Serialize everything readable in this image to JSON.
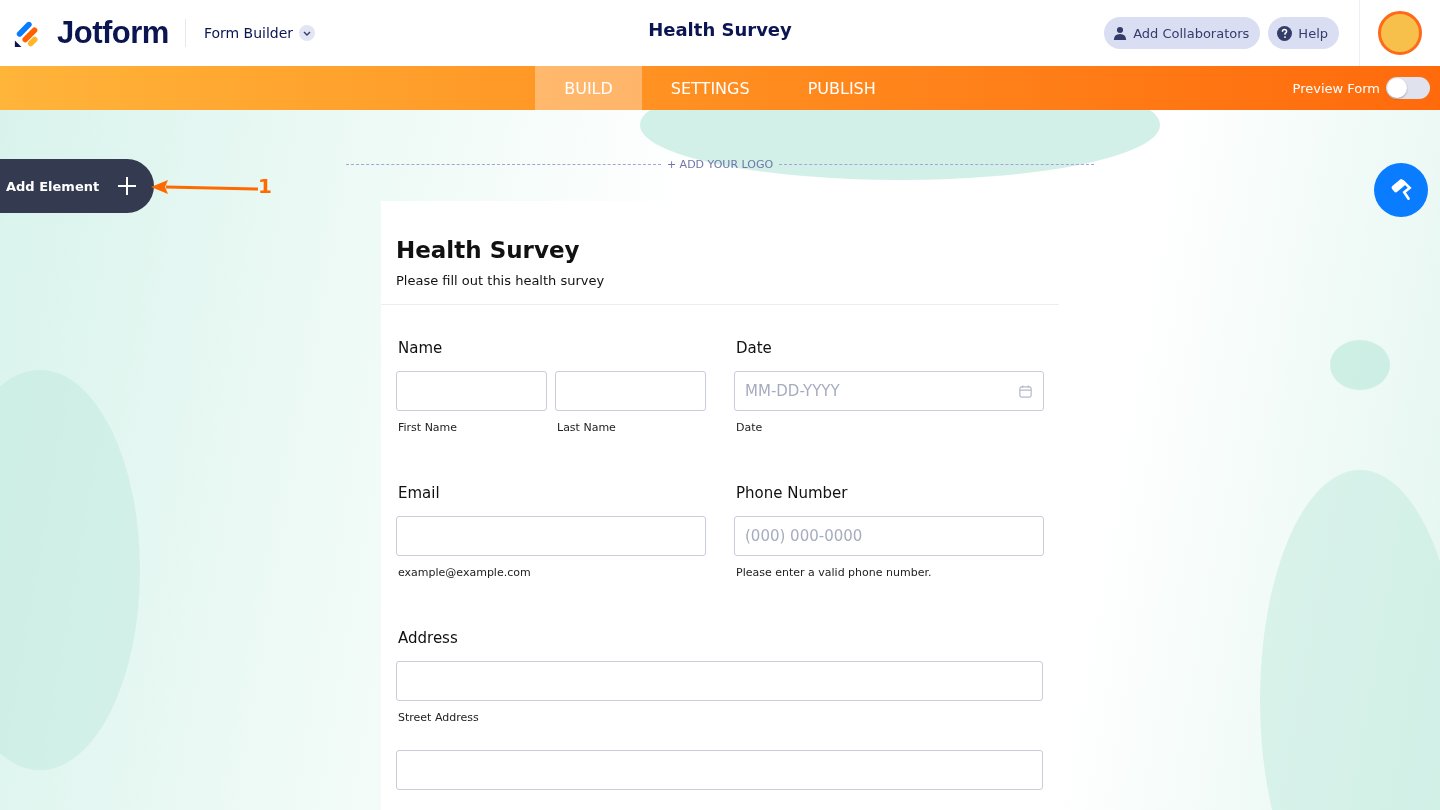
{
  "header": {
    "logo": "Jotform",
    "product": "Form Builder",
    "title": "Health Survey",
    "buttons": [
      {
        "kind": "collaborators",
        "label": "Add Collaborators"
      },
      {
        "kind": "help",
        "label": "Help"
      }
    ]
  },
  "nav": {
    "tabs": [
      {
        "label": "BUILD",
        "selected": true
      },
      {
        "label": "SETTINGS",
        "selected": false
      },
      {
        "label": "PUBLISH",
        "selected": false
      }
    ],
    "preview": {
      "label": "Preview Form",
      "on": false
    }
  },
  "canvas": {
    "add_element": "Add Element",
    "annotation": "1",
    "logo_placeholder": "+ ADD YOUR LOGO"
  },
  "form": {
    "title": "Health Survey",
    "subtitle": "Please fill out this health survey",
    "rows": [
      [
        {
          "kind": "name",
          "label": "Name",
          "inputs": [
            {
              "sublabel": "First Name"
            },
            {
              "sublabel": "Last Name"
            }
          ]
        },
        {
          "kind": "date",
          "label": "Date",
          "placeholder": "MM-DD-YYYY",
          "sublabel": "Date"
        }
      ],
      [
        {
          "kind": "email",
          "label": "Email",
          "sublabel": "example@example.com"
        },
        {
          "kind": "phone",
          "label": "Phone Number",
          "placeholder": "(000) 000-0000",
          "sublabel": "Please enter a valid phone number."
        }
      ],
      [
        {
          "kind": "address",
          "label": "Address",
          "inputs": [
            {
              "kind": "text",
              "sublabel": "Street Address"
            },
            {
              "kind": "text"
            }
          ]
        }
      ]
    ]
  }
}
